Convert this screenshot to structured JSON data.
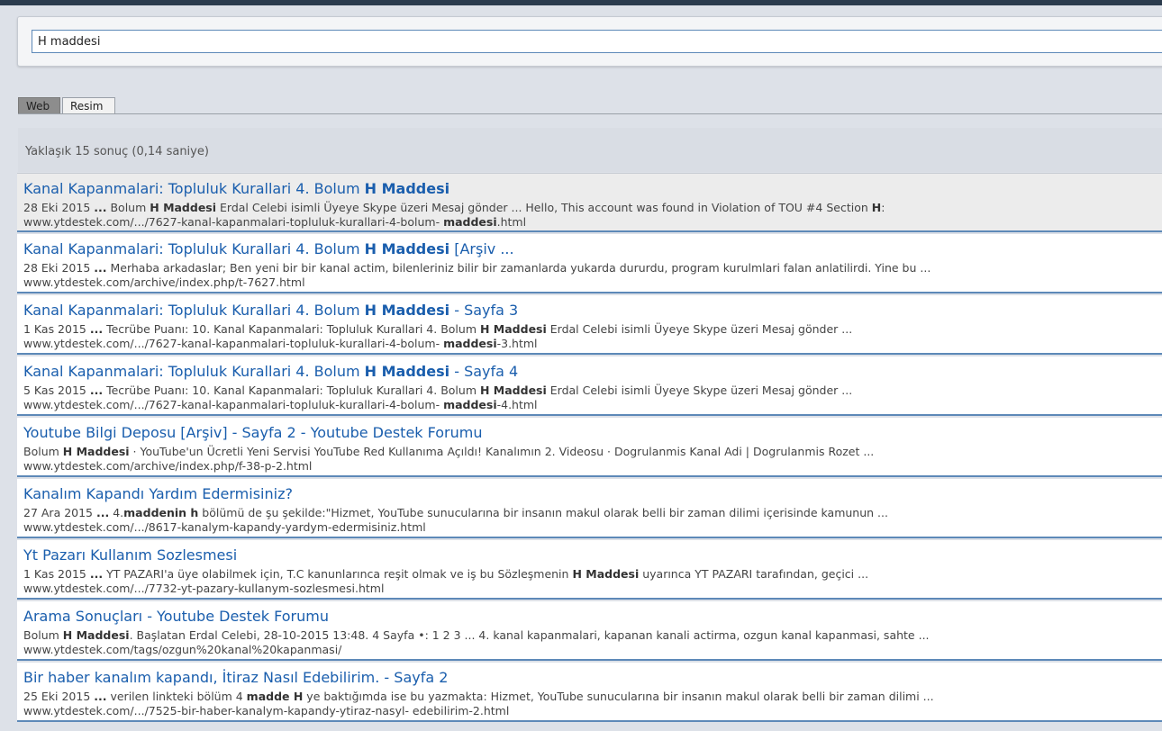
{
  "search": {
    "query": "H maddesi"
  },
  "tabs": [
    {
      "label": "Web",
      "active": true
    },
    {
      "label": "Resim",
      "active": false
    }
  ],
  "stats": "Yaklaşık 15 sonuç (0,14 saniye)",
  "colors": {
    "link": "#1a5ead",
    "separator": "#5d89b8",
    "background": "#dde1e8"
  },
  "results": [
    {
      "title": [
        {
          "t": "Kanal Kapanmalari: Topluluk Kurallari 4. Bolum "
        },
        {
          "t": "H Maddesi",
          "b": true
        }
      ],
      "snippet": [
        {
          "t": "28 Eki 2015 "
        },
        {
          "t": "...",
          "b": true
        },
        {
          "t": " Bolum "
        },
        {
          "t": "H Maddesi",
          "b": true
        },
        {
          "t": " Erdal Celebi isimli Üyeye Skype üzeri Mesaj gönder ... Hello, This account was found in Violation of TOU #4 Section "
        },
        {
          "t": "H",
          "b": true
        },
        {
          "t": ":"
        }
      ],
      "url": [
        {
          "t": "www.ytdestek.com/.../7627-kanal-kapanmalari-topluluk-kurallari-4-bolum- "
        },
        {
          "t": "maddesi",
          "b": true
        },
        {
          "t": ".html"
        }
      ]
    },
    {
      "title": [
        {
          "t": "Kanal Kapanmalari: Topluluk Kurallari 4. Bolum "
        },
        {
          "t": "H Maddesi",
          "b": true
        },
        {
          "t": " [Arşiv ..."
        }
      ],
      "snippet": [
        {
          "t": "28 Eki 2015 "
        },
        {
          "t": "...",
          "b": true
        },
        {
          "t": " Merhaba arkadaslar; Ben yeni bir bir kanal actim, bilenleriniz bilir bir zamanlarda yukarda dururdu, program kurulmlari falan anlatilirdi. Yine bu ..."
        }
      ],
      "url": [
        {
          "t": "www.ytdestek.com/archive/index.php/t-7627.html"
        }
      ]
    },
    {
      "title": [
        {
          "t": "Kanal Kapanmalari: Topluluk Kurallari 4. Bolum "
        },
        {
          "t": "H Maddesi",
          "b": true
        },
        {
          "t": " - Sayfa 3"
        }
      ],
      "snippet": [
        {
          "t": "1 Kas 2015 "
        },
        {
          "t": "...",
          "b": true
        },
        {
          "t": " Tecrübe Puanı: 10. Kanal Kapanmalari: Topluluk Kurallari 4. Bolum "
        },
        {
          "t": "H Maddesi",
          "b": true
        },
        {
          "t": " Erdal Celebi isimli Üyeye Skype üzeri Mesaj gönder ..."
        }
      ],
      "url": [
        {
          "t": "www.ytdestek.com/.../7627-kanal-kapanmalari-topluluk-kurallari-4-bolum- "
        },
        {
          "t": "maddesi",
          "b": true
        },
        {
          "t": "-3.html"
        }
      ]
    },
    {
      "title": [
        {
          "t": "Kanal Kapanmalari: Topluluk Kurallari 4. Bolum "
        },
        {
          "t": "H Maddesi",
          "b": true
        },
        {
          "t": " - Sayfa 4"
        }
      ],
      "snippet": [
        {
          "t": "5 Kas 2015 "
        },
        {
          "t": "...",
          "b": true
        },
        {
          "t": " Tecrübe Puanı: 10. Kanal Kapanmalari: Topluluk Kurallari 4. Bolum "
        },
        {
          "t": "H Maddesi",
          "b": true
        },
        {
          "t": " Erdal Celebi isimli Üyeye Skype üzeri Mesaj gönder ..."
        }
      ],
      "url": [
        {
          "t": "www.ytdestek.com/.../7627-kanal-kapanmalari-topluluk-kurallari-4-bolum- "
        },
        {
          "t": "maddesi",
          "b": true
        },
        {
          "t": "-4.html"
        }
      ]
    },
    {
      "title": [
        {
          "t": "Youtube Bilgi Deposu [Arşiv] - Sayfa 2 - Youtube Destek Forumu"
        }
      ],
      "snippet": [
        {
          "t": "Bolum "
        },
        {
          "t": "H Maddesi",
          "b": true
        },
        {
          "t": " · YouTube'un Ücretli Yeni Servisi YouTube Red Kullanıma Açıldı! Kanalımın 2. Videosu · Dogrulanmis Kanal Adi | Dogrulanmis Rozet ..."
        }
      ],
      "url": [
        {
          "t": "www.ytdestek.com/archive/index.php/f-38-p-2.html"
        }
      ]
    },
    {
      "title": [
        {
          "t": "Kanalım Kapandı Yardım Edermisiniz?"
        }
      ],
      "snippet": [
        {
          "t": "27 Ara 2015 "
        },
        {
          "t": "...",
          "b": true
        },
        {
          "t": " 4."
        },
        {
          "t": "maddenin h",
          "b": true
        },
        {
          "t": " bölümü de şu şekilde:\"Hizmet, YouTube sunucularına bir insanın makul olarak belli bir zaman dilimi içerisinde kamunun ..."
        }
      ],
      "url": [
        {
          "t": "www.ytdestek.com/.../8617-kanalym-kapandy-yardym-edermisiniz.html"
        }
      ]
    },
    {
      "title": [
        {
          "t": "Yt Pazarı Kullanım Sozlesmesi"
        }
      ],
      "snippet": [
        {
          "t": "1 Kas 2015 "
        },
        {
          "t": "...",
          "b": true
        },
        {
          "t": " YT PAZARI'a üye olabilmek için, T.C kanunlarınca reşit olmak ve iş bu Sözleşmenin "
        },
        {
          "t": "H Maddesi",
          "b": true
        },
        {
          "t": " uyarınca YT PAZARI tarafından, geçici ..."
        }
      ],
      "url": [
        {
          "t": "www.ytdestek.com/.../7732-yt-pazary-kullanym-sozlesmesi.html"
        }
      ]
    },
    {
      "title": [
        {
          "t": "Arama Sonuçları - Youtube Destek Forumu"
        }
      ],
      "snippet": [
        {
          "t": "Bolum "
        },
        {
          "t": "H Maddesi",
          "b": true
        },
        {
          "t": ". Başlatan Erdal Celebi, 28-10-2015 13:48. 4 Sayfa •: 1 2 3 ... 4. kanal kapanmalari, kapanan kanali actirma, ozgun kanal kapanmasi, sahte ..."
        }
      ],
      "url": [
        {
          "t": "www.ytdestek.com/tags/ozgun%20kanal%20kapanmasi/"
        }
      ]
    },
    {
      "title": [
        {
          "t": "Bir haber kanalım kapandı, İtiraz Nasıl Edebilirim. - Sayfa 2"
        }
      ],
      "snippet": [
        {
          "t": "25 Eki 2015 "
        },
        {
          "t": "...",
          "b": true
        },
        {
          "t": " verilen linkteki bölüm 4 "
        },
        {
          "t": "madde H",
          "b": true
        },
        {
          "t": " ye baktığımda ise bu yazmakta: Hizmet, YouTube sunucularına bir insanın makul olarak belli bir zaman dilimi ..."
        }
      ],
      "url": [
        {
          "t": "www.ytdestek.com/.../7525-bir-haber-kanalym-kapandy-ytiraz-nasyl- edebilirim-2.html"
        }
      ]
    }
  ]
}
